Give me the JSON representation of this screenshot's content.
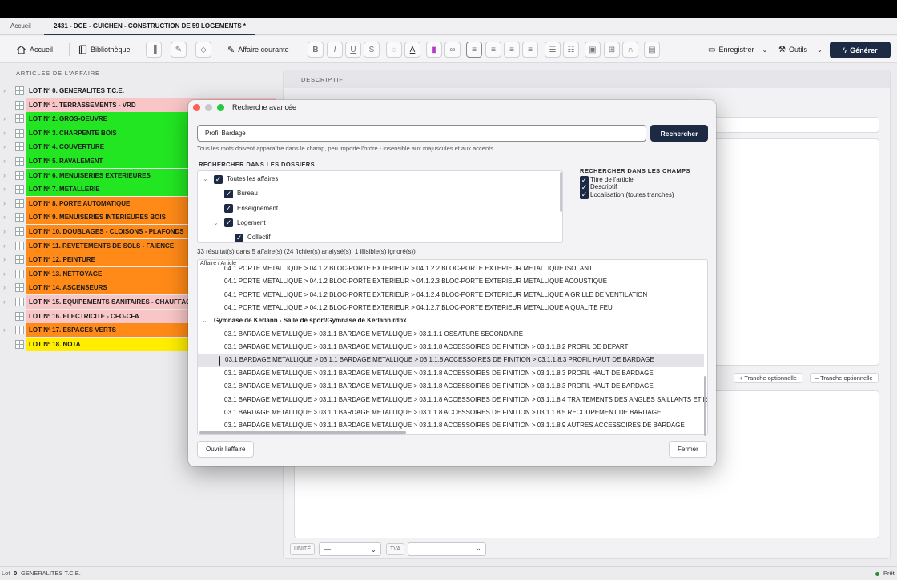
{
  "tabs": {
    "home": "Accueil",
    "document": "2431 - DCE - GUICHEN - CONSTRUCTION DE 59 LOGEMENTS *"
  },
  "toolbar": {
    "home": "Accueil",
    "library": "Bibliothèque",
    "current_case": "Affaire courante",
    "save": "Enregistrer",
    "tools": "Outils",
    "generate": "Générer",
    "format_buttons": [
      "B",
      "I",
      "U",
      "S"
    ]
  },
  "left": {
    "title": "ARTICLES DE L'AFFAIRE",
    "lots": [
      {
        "label": "LOT Nº 0. GENERALITES T.C.E.",
        "color": "#ececee",
        "chevron": true
      },
      {
        "label": "LOT Nº 1. TERRASSEMENTS - VRD",
        "color": "#f8c6c6",
        "chevron": false
      },
      {
        "label": "LOT Nº 2. GROS-OEUVRE",
        "color": "#22e622",
        "chevron": true
      },
      {
        "label": "LOT Nº 3. CHARPENTE BOIS",
        "color": "#22e622",
        "chevron": true
      },
      {
        "label": "LOT Nº 4. COUVERTURE",
        "color": "#22e622",
        "chevron": true
      },
      {
        "label": "LOT Nº 5. RAVALEMENT",
        "color": "#22e622",
        "chevron": true
      },
      {
        "label": "LOT Nº 6. MENUISERIES EXTERIEURES",
        "color": "#22e622",
        "chevron": true
      },
      {
        "label": "LOT Nº 7. METALLERIE",
        "color": "#22e622",
        "chevron": true
      },
      {
        "label": "LOT Nº 8. PORTE AUTOMATIQUE",
        "color": "#ff8a17",
        "chevron": true
      },
      {
        "label": "LOT Nº 9. MENUISERIES INTERIEURES BOIS",
        "color": "#ff8a17",
        "chevron": true
      },
      {
        "label": "LOT Nº 10. DOUBLAGES - CLOISONS - PLAFONDS",
        "color": "#ff8a17",
        "chevron": true
      },
      {
        "label": "LOT Nº 11. REVETEMENTS DE SOLS - FAIENCE",
        "color": "#ff8a17",
        "chevron": true
      },
      {
        "label": "LOT Nº 12. PEINTURE",
        "color": "#ff8a17",
        "chevron": true
      },
      {
        "label": "LOT Nº 13. NETTOYAGE",
        "color": "#ff8a17",
        "chevron": true
      },
      {
        "label": "LOT Nº 14. ASCENSEURS",
        "color": "#ff8a17",
        "chevron": true
      },
      {
        "label": "LOT Nº 15. EQUIPEMENTS SANITAIRES - CHAUFFAGE",
        "color": "#f8c6c6",
        "chevron": true
      },
      {
        "label": "LOT Nº 16. ELECTRICITE - CFO-CFA",
        "color": "#f8c6c6",
        "chevron": false
      },
      {
        "label": "LOT Nº 17. ESPACES VERTS",
        "color": "#ff8a17",
        "chevron": true
      },
      {
        "label": "LOT Nº 18. NOTA",
        "color": "#ffee00",
        "chevron": false
      }
    ]
  },
  "right": {
    "descriptif_title": "DESCRIPTIF",
    "add_tranche": "+ Tranche optionnelle",
    "remove_tranche": "– Tranche optionnelle",
    "unit_label": "UNITÉ",
    "unit_value": "—",
    "tva_label": "TVA",
    "tva_value": ""
  },
  "status": {
    "lot_prefix": "Lot",
    "lot_number": "0",
    "lot_name": "GENERALITES T.C.E.",
    "ready": "Prêt"
  },
  "dialog": {
    "title": "Recherche avancée",
    "search_value": "Profil Bardage",
    "search_button": "Rechercher",
    "hint": "Tous les mots doivent apparaître dans le champ, peu importe l'ordre - insensible aux majuscules et aux accents.",
    "folders_title": "RECHERCHER DANS LES DOSSIERS",
    "folders": [
      {
        "label": "Toutes les affaires",
        "indent": 0,
        "chevron": true,
        "checked": true
      },
      {
        "label": "Bureau",
        "indent": 1,
        "chevron": false,
        "checked": true
      },
      {
        "label": "Enseignement",
        "indent": 1,
        "chevron": false,
        "checked": true
      },
      {
        "label": "Logement",
        "indent": 1,
        "chevron": true,
        "checked": true
      },
      {
        "label": "Collectif",
        "indent": 2,
        "chevron": false,
        "checked": true
      }
    ],
    "fields_title": "RECHERCHER DANS LES CHAMPS",
    "fields": [
      "Titre de l'article",
      "Descriptif",
      "Localisation (toutes tranches)"
    ],
    "result_count": "33 résultat(s) dans 5 affaire(s) (24 fichier(s) analysé(s), 1 illisible(s) ignoré(s))",
    "column_header": "Affaire / Article",
    "results": [
      {
        "text": "04.1 PORTE METALLIQUE > 04.1.2 BLOC-PORTE EXTERIEUR > 04.1.2.2 BLOC-PORTE EXTERIEUR METALLIQUE ISOLANT",
        "type": "item",
        "selected": false
      },
      {
        "text": "04.1 PORTE METALLIQUE > 04.1.2 BLOC-PORTE EXTERIEUR > 04.1.2.3 BLOC-PORTE EXTERIEUR METALLIQUE ACOUSTIQUE",
        "type": "item",
        "selected": false
      },
      {
        "text": "04.1 PORTE METALLIQUE > 04.1.2 BLOC-PORTE EXTERIEUR > 04.1.2.4 BLOC-PORTE EXTERIEUR METALLIQUE A GRILLE DE VENTILATION",
        "type": "item",
        "selected": false
      },
      {
        "text": "04.1 PORTE METALLIQUE > 04.1.2 BLOC-PORTE EXTERIEUR > 04.1.2.7 BLOC-PORTE EXTERIEUR METALLIQUE A QUALITE FEU",
        "type": "item",
        "selected": false
      },
      {
        "text": "Gymnase de Kerlann - Salle de sport/Gymnase de Kerlann.rdbx",
        "type": "group",
        "selected": false
      },
      {
        "text": "03.1 BARDAGE METALLIQUE > 03.1.1 BARDAGE METALLIQUE > 03.1.1.1 OSSATURE SECONDAIRE",
        "type": "item",
        "selected": false
      },
      {
        "text": "03.1 BARDAGE METALLIQUE > 03.1.1 BARDAGE METALLIQUE > 03.1.1.8 ACCESSOIRES DE FINITION > 03.1.1.8.2 PROFIL DE DEPART",
        "type": "item",
        "selected": false
      },
      {
        "text": "03.1 BARDAGE METALLIQUE > 03.1.1 BARDAGE METALLIQUE > 03.1.1.8 ACCESSOIRES DE FINITION > 03.1.1.8.3 PROFIL HAUT DE BARDAGE",
        "type": "item",
        "selected": true
      },
      {
        "text": "03.1 BARDAGE METALLIQUE > 03.1.1 BARDAGE METALLIQUE > 03.1.1.8 ACCESSOIRES DE FINITION > 03.1.1.8.3 PROFIL HAUT DE BARDAGE",
        "type": "item",
        "selected": false
      },
      {
        "text": "03.1 BARDAGE METALLIQUE > 03.1.1 BARDAGE METALLIQUE > 03.1.1.8 ACCESSOIRES DE FINITION > 03.1.1.8.3 PROFIL HAUT DE BARDAGE",
        "type": "item",
        "selected": false
      },
      {
        "text": "03.1 BARDAGE METALLIQUE > 03.1.1 BARDAGE METALLIQUE > 03.1.1.8 ACCESSOIRES DE FINITION > 03.1.1.8.4 TRAITEMENTS DES ANGLES SAILLANTS ET RENTRANTS",
        "type": "item",
        "selected": false
      },
      {
        "text": "03.1 BARDAGE METALLIQUE > 03.1.1 BARDAGE METALLIQUE > 03.1.1.8 ACCESSOIRES DE FINITION > 03.1.1.8.5 RECOUPEMENT DE BARDAGE",
        "type": "item",
        "selected": false
      },
      {
        "text": "03.1 BARDAGE METALLIQUE > 03.1.1 BARDAGE METALLIQUE > 03.1.1.8 ACCESSOIRES DE FINITION > 03.1.1.8.9 AUTRES ACCESSOIRES DE BARDAGE",
        "type": "item",
        "selected": false
      }
    ],
    "open_button": "Ouvrir l'affaire",
    "close_button": "Fermer"
  },
  "colors": {
    "accent": "#1c2a44",
    "selection": "#e4e4e8"
  }
}
